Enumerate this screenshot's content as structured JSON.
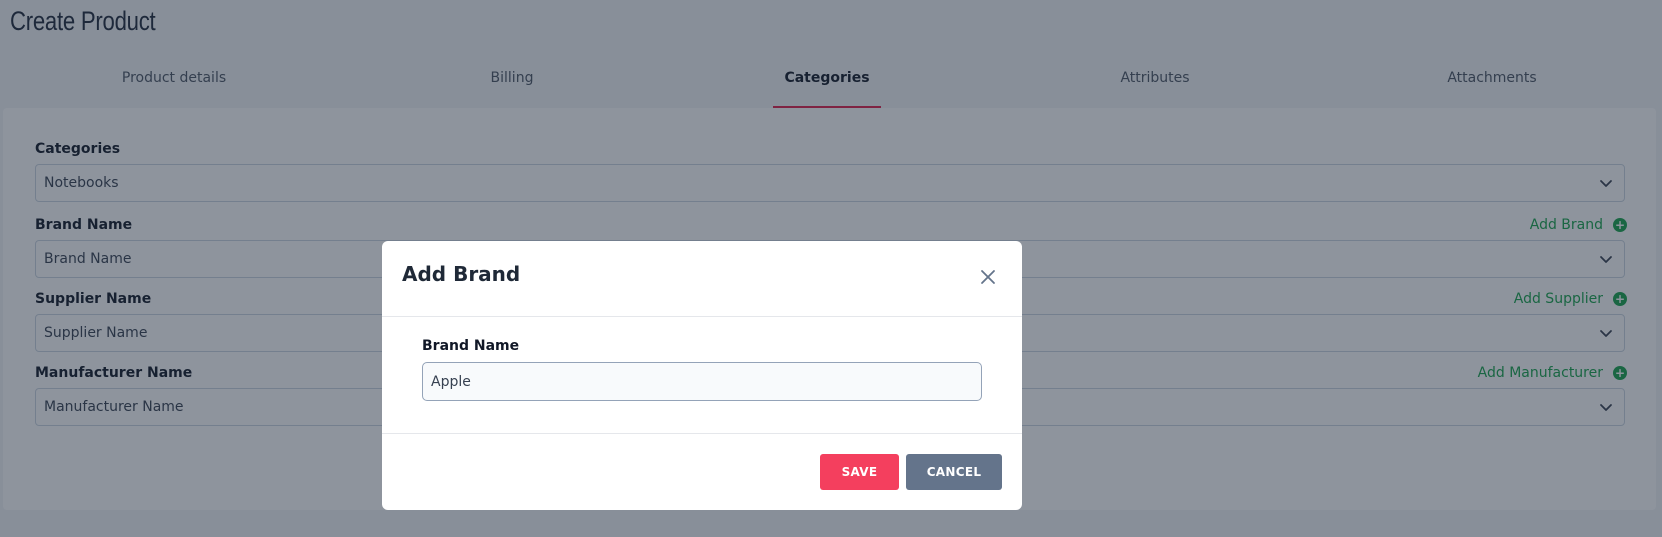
{
  "page": {
    "title": "Create Product"
  },
  "tabs": [
    {
      "label": "Product details"
    },
    {
      "label": "Billing"
    },
    {
      "label": "Categories"
    },
    {
      "label": "Attributes"
    },
    {
      "label": "Attachments"
    }
  ],
  "form": {
    "categories": {
      "label": "Categories",
      "value": "Notebooks"
    },
    "brand": {
      "label": "Brand Name",
      "placeholder": "Brand Name",
      "add_label": "Add Brand"
    },
    "supplier": {
      "label": "Supplier Name",
      "placeholder": "Supplier Name",
      "add_label": "Add Supplier"
    },
    "manufacturer": {
      "label": "Manufacturer Name",
      "placeholder": "Manufacturer Name",
      "add_label": "Add Manufacturer"
    }
  },
  "modal": {
    "title": "Add Brand",
    "field_label": "Brand Name",
    "field_value": "Apple",
    "save_label": "SAVE",
    "cancel_label": "CANCEL"
  },
  "colors": {
    "accent": "#e11d48",
    "save": "#f43f5e",
    "cancel": "#64748b",
    "add_link": "#16a34a"
  },
  "icons": {
    "chevron": "chevron-down-icon",
    "plus": "plus-circle-icon",
    "close": "close-icon"
  }
}
